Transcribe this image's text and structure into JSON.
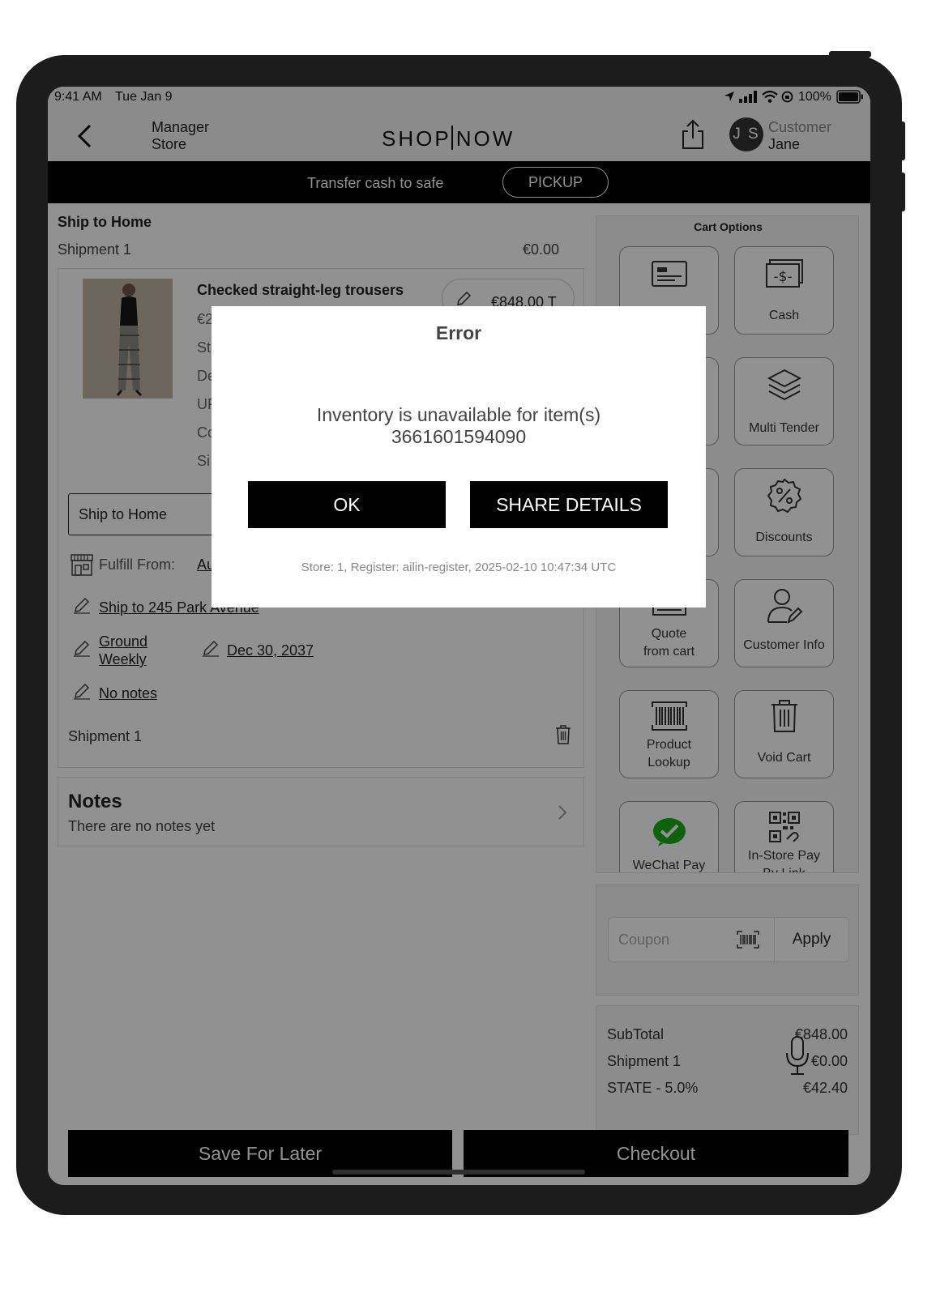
{
  "status_bar": {
    "time": "9:41 AM",
    "date": "Tue Jan 9",
    "battery": "100%"
  },
  "header": {
    "left_line1": "Manager",
    "left_line2": "Store",
    "logo_left": "SHOP",
    "logo_right": "NOW",
    "avatar_initials": "J S",
    "right_line1": "Customer",
    "right_line2": "Jane"
  },
  "banner": {
    "text": "Transfer cash to safe",
    "button": "PICKUP"
  },
  "shipment": {
    "section_title": "Ship to Home",
    "label": "Shipment 1",
    "amount": "€0.00",
    "item_name": "Checked straight-leg trousers",
    "item_price": "€848.00 T",
    "detail_prefixes": [
      "€2",
      "St",
      "De",
      "UF",
      "Co",
      "Si"
    ],
    "method_select": "Ship to Home",
    "fulfill_label": "Fulfill From:",
    "fulfill_value": "Au",
    "ship_to": "Ship to 245 Park Avenue",
    "shipping_line1": "Ground",
    "shipping_line2": "Weekly",
    "ship_date": "Dec 30, 2037",
    "notes_link": "No notes",
    "footer_label": "Shipment 1"
  },
  "notes": {
    "title": "Notes",
    "subtitle": "There are no notes yet"
  },
  "cart_options": {
    "title": "Cart Options",
    "tiles": {
      "cash": "Cash",
      "multi_tender": "Multi Tender",
      "discounts": "Discounts",
      "quote_line1": "Quote",
      "quote_line2": "from cart",
      "customer_info": "Customer Info",
      "product_lookup_line1": "Product",
      "product_lookup_line2": "Lookup",
      "void_cart": "Void Cart",
      "wechat_pay": "WeChat Pay",
      "instore_pay_line1": "In-Store Pay",
      "instore_pay_line2": "By Link"
    }
  },
  "coupon": {
    "placeholder": "Coupon",
    "apply": "Apply"
  },
  "totals": {
    "rows": [
      {
        "label": "SubTotal",
        "value": "€848.00"
      },
      {
        "label": "Shipment 1",
        "value": "€0.00"
      },
      {
        "label": "STATE - 5.0%",
        "value": "€42.40"
      }
    ]
  },
  "actions": {
    "save_for_later": "Save For Later",
    "checkout": "Checkout"
  },
  "modal": {
    "title": "Error",
    "message_line1": "Inventory is unavailable for item(s)",
    "message_line2": "3661601594090",
    "ok": "OK",
    "share": "SHARE DETAILS",
    "footer": "Store: 1, Register: ailin-register, 2025-02-10 10:47:34 UTC"
  },
  "colors": {
    "wechat_green": "#1aad19",
    "overlay": "#000000"
  }
}
